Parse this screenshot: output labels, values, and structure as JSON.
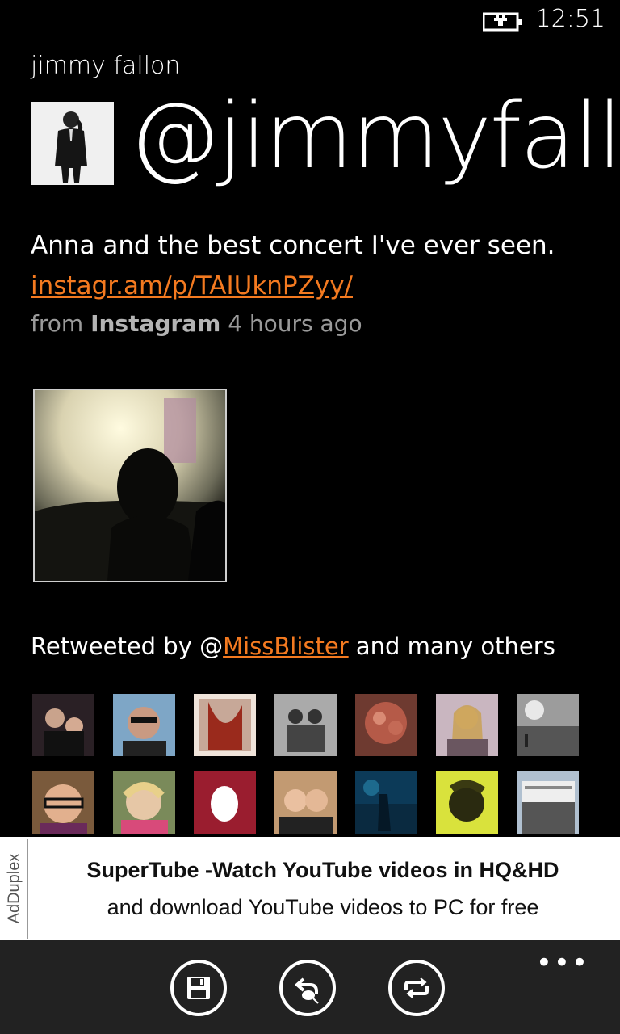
{
  "status": {
    "time": "12:51",
    "battery_icon": "battery-charging-icon"
  },
  "profile": {
    "name": "jimmy fallon",
    "handle": "@jimmyfallo"
  },
  "tweet": {
    "text": "Anna and the best concert I've ever seen.",
    "link": "instagr.am/p/TAIUknPZyy/",
    "meta_from": "from",
    "meta_source": "Instagram",
    "meta_time": "4 hours ago"
  },
  "retweets": {
    "prefix": "Retweeted by @",
    "user": "MissBlister",
    "suffix": "and many others"
  },
  "ad": {
    "tag": "AdDuplex",
    "title": "SuperTube -Watch YouTube videos in HQ&HD",
    "subtitle": "and download YouTube videos to PC for free"
  },
  "appbar": {
    "more_label": "•••",
    "buttons": [
      "save-icon",
      "reply-icon",
      "retweet-icon"
    ]
  },
  "colors": {
    "accent": "#f47a20",
    "background": "#000000",
    "appbar": "#222222"
  }
}
